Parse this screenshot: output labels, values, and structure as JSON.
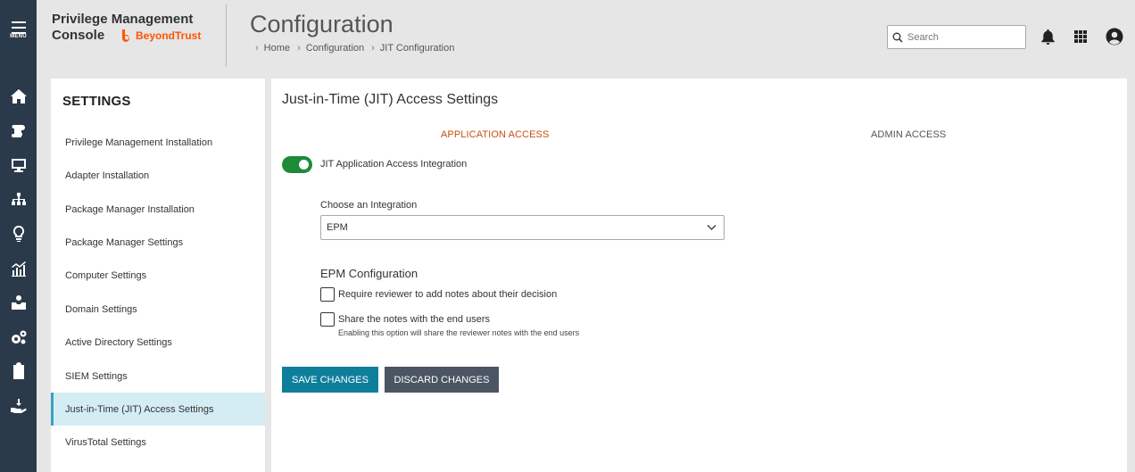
{
  "app": {
    "menu_label": "MENU",
    "brand_line1": "Privilege Management",
    "brand_line2": "Console",
    "brand_logo_text": "BeyondTrust",
    "brand_color": "#ff5500"
  },
  "header": {
    "title": "Configuration",
    "breadcrumb": [
      "Home",
      "Configuration",
      "JIT Configuration"
    ],
    "search_placeholder": "Search",
    "icons": [
      "bell-icon",
      "apps-grid-icon",
      "user-account-icon"
    ]
  },
  "rail": {
    "icons": [
      "home-icon",
      "scroll-icon",
      "monitor-icon",
      "sitemap-icon",
      "lightbulb-icon",
      "analytics-icon",
      "inbox-user-icon",
      "cogs-icon",
      "clipboard-icon",
      "hand-download-icon"
    ]
  },
  "settings": {
    "heading": "SETTINGS",
    "items": [
      {
        "label": "Privilege Management Installation"
      },
      {
        "label": "Adapter Installation"
      },
      {
        "label": "Package Manager Installation"
      },
      {
        "label": "Package Manager Settings"
      },
      {
        "label": "Computer Settings"
      },
      {
        "label": "Domain Settings"
      },
      {
        "label": "Active Directory Settings"
      },
      {
        "label": "SIEM Settings"
      },
      {
        "label": "Just-in-Time (JIT) Access Settings",
        "active": true
      },
      {
        "label": "VirusTotal Settings"
      }
    ]
  },
  "main": {
    "title": "Just-in-Time (JIT) Access Settings",
    "tabs": [
      {
        "label": "APPLICATION ACCESS",
        "active": true
      },
      {
        "label": "ADMIN ACCESS",
        "active": false
      }
    ],
    "toggle_label": "JIT Application Access Integration",
    "toggle_on": true,
    "integration_label": "Choose an Integration",
    "integration_value": "EPM",
    "epm_title": "EPM Configuration",
    "checkbox_reviewer_notes": "Require reviewer to add notes about their decision",
    "checkbox_share_notes": "Share the notes with the end users",
    "share_notes_hint": "Enabling this option will share the reviewer notes with the end users",
    "save_label": "SAVE CHANGES",
    "discard_label": "DISCARD CHANGES"
  },
  "colors": {
    "rail_bg": "#2b3a4a",
    "active_tab": "#c8500f",
    "toggle_on": "#1f8a3a",
    "save_button": "#0e7f9b",
    "discard_button": "#4b5563",
    "active_item_bg": "#d4ecf4"
  }
}
